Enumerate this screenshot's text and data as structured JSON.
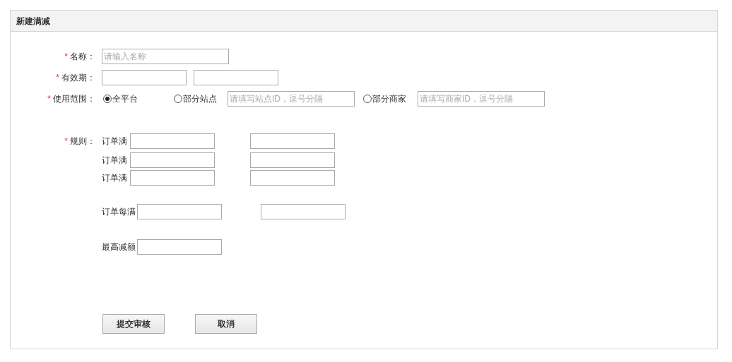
{
  "panel": {
    "title": "新建满减"
  },
  "name_field": {
    "required_mark": "*",
    "label": "名称：",
    "placeholder": "请输入名称"
  },
  "validity_field": {
    "required_mark": "*",
    "label": "有效期："
  },
  "scope_field": {
    "required_mark": "*",
    "label": "使用范围：",
    "options": [
      {
        "label": "全平台",
        "selected": true
      },
      {
        "label": "部分站点",
        "selected": false,
        "placeholder": "请填写站点ID，逗号分隔"
      },
      {
        "label": "部分商家",
        "selected": false,
        "placeholder": "请填写商家ID，逗号分隔"
      }
    ]
  },
  "rules": {
    "required_mark": "*",
    "label": "规则：",
    "tiers": [
      {
        "label": "订单满"
      },
      {
        "label": "订单满"
      },
      {
        "label": "订单满"
      }
    ],
    "per_amount": {
      "label": "订单每满"
    },
    "max_discount": {
      "label": "最高减额"
    }
  },
  "buttons": [
    {
      "label": "提交审核"
    },
    {
      "label": "取消"
    }
  ]
}
